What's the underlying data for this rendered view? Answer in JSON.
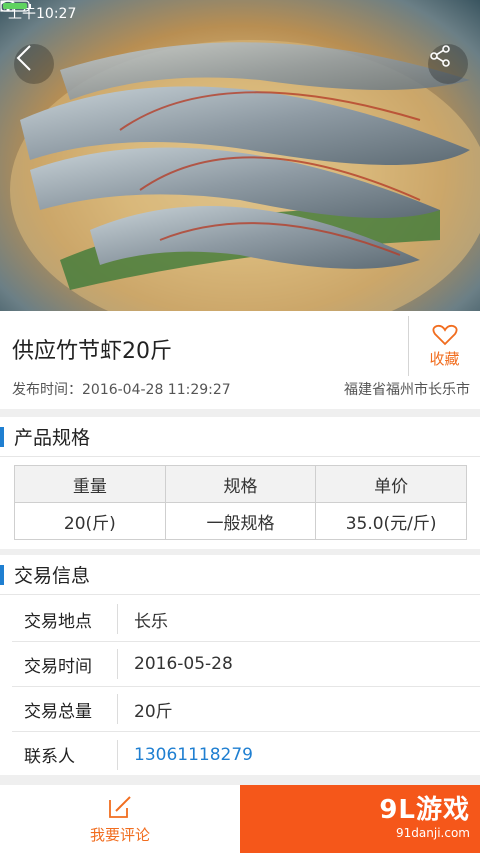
{
  "status": {
    "time": "上午10:27"
  },
  "product": {
    "title": "供应竹节虾20斤",
    "favorite_label": "收藏",
    "publish_time": "发布时间：2016-04-28 11:29:27",
    "location": "福建省福州市长乐市"
  },
  "spec_section": {
    "title": "产品规格",
    "headers": [
      "重量",
      "规格",
      "单价"
    ],
    "row": [
      "20(斤)",
      "一般规格",
      "35.0(元/斤)"
    ]
  },
  "trade_section": {
    "title": "交易信息",
    "rows": [
      {
        "label": "交易地点",
        "value": "长乐"
      },
      {
        "label": "交易时间",
        "value": "2016-05-28"
      },
      {
        "label": "交易总量",
        "value": "20斤"
      },
      {
        "label": "联系人",
        "value": "13061118279"
      }
    ]
  },
  "bottom": {
    "comment_label": "我要评论",
    "watermark_main": "9L游戏",
    "watermark_sub": "91danji.com"
  },
  "colors": {
    "accent": "#f16d1f",
    "link": "#1f7fd1",
    "contact_bg": "#f5571a"
  }
}
